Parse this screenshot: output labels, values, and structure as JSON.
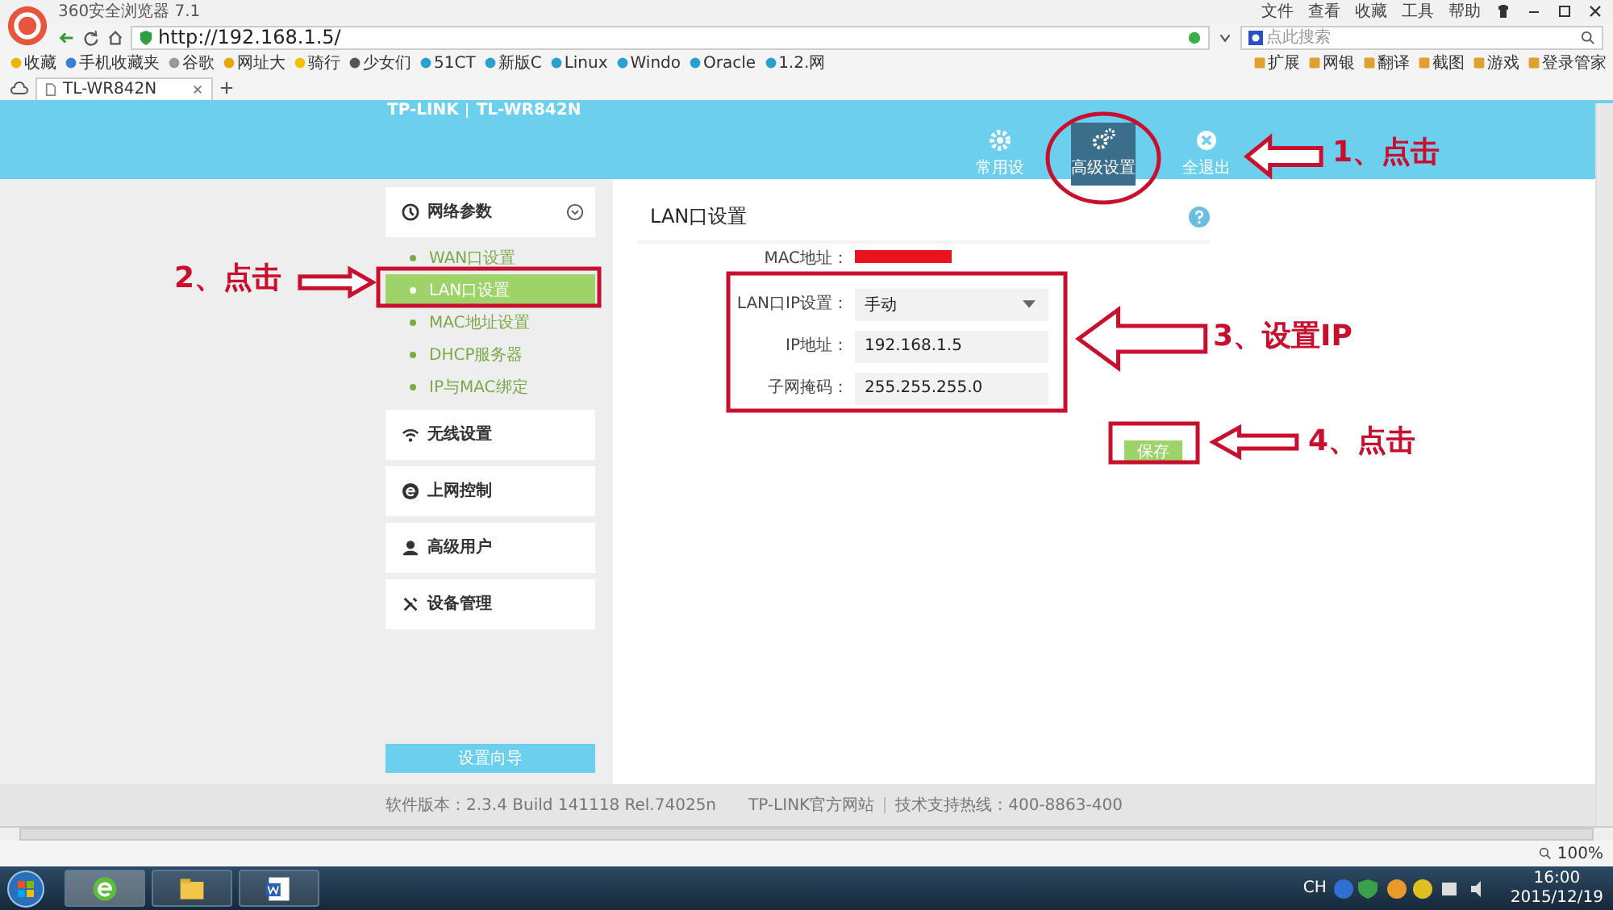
{
  "browser": {
    "title": "360安全浏览器 7.1",
    "menu": [
      "文件",
      "查看",
      "收藏",
      "工具",
      "帮助"
    ],
    "url": "http://192.168.1.5/",
    "search_placeholder": "点此搜索",
    "bookmarks": [
      "收藏",
      "手机收藏夹",
      "谷歌",
      "网址大",
      "骑行",
      "少女们",
      "51CT",
      "新版C",
      "Linux",
      "Windo",
      "Oracle",
      "1.2.网"
    ],
    "tools": [
      "扩展",
      "网银",
      "翻译",
      "截图",
      "游戏",
      "登录管家"
    ],
    "tabs": [
      {
        "label": "TL-WR842N",
        "selected": true
      }
    ],
    "zoom": "100%"
  },
  "router": {
    "logo": "TP-LINK",
    "model": "TL-WR842N",
    "nav": [
      {
        "label": "常用设",
        "selected": false
      },
      {
        "label": "高级设置",
        "selected": true
      },
      {
        "label": "全退出",
        "selected": false
      }
    ],
    "menu": [
      {
        "label": "网络参数",
        "expanded": true,
        "children": [
          {
            "label": "WAN口设置",
            "selected": false
          },
          {
            "label": "LAN口设置",
            "selected": true
          },
          {
            "label": "MAC地址设置",
            "selected": false
          },
          {
            "label": "DHCP服务器",
            "selected": false
          },
          {
            "label": "IP与MAC绑定",
            "selected": false
          }
        ]
      },
      {
        "label": "无线设置"
      },
      {
        "label": "上网控制"
      },
      {
        "label": "高级用户"
      },
      {
        "label": "设备管理"
      }
    ],
    "wizard_button": "设置向导",
    "panel": {
      "title": "LAN口设置",
      "fields": [
        {
          "label": "MAC地址：",
          "kind": "redacted"
        },
        {
          "label": "LAN口IP设置：",
          "kind": "select",
          "value": "手动"
        },
        {
          "label": "IP地址：",
          "kind": "input",
          "value": "192.168.1.5"
        },
        {
          "label": "子网掩码：",
          "kind": "input",
          "value": "255.255.255.0"
        }
      ],
      "save_button": "保存"
    },
    "footer": {
      "version": "软件版本：2.3.4 Build 141118 Rel.74025n",
      "links": [
        "TP-LINK官方网站",
        "技术支持热线：400-8863-400"
      ]
    }
  },
  "annotations": [
    {
      "label": "1、点击"
    },
    {
      "label": "2、点击"
    },
    {
      "label": "3、设置IP"
    },
    {
      "label": "4、点击"
    }
  ],
  "taskbar": {
    "language": "CH",
    "time": "16:00",
    "date": "2015/12/19"
  }
}
